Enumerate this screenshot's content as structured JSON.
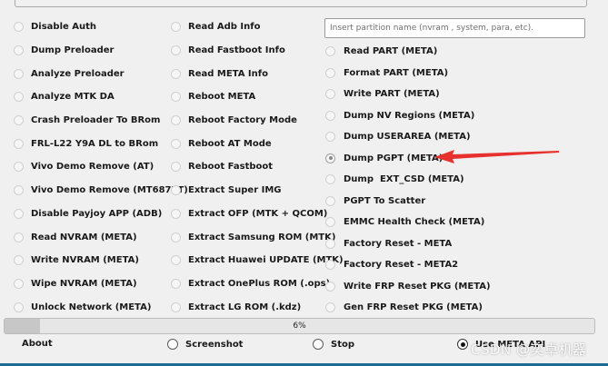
{
  "column1": [
    {
      "label": "Disable Auth"
    },
    {
      "label": "Dump Preloader"
    },
    {
      "label": "Analyze Preloader"
    },
    {
      "label": "Analyze MTK DA"
    },
    {
      "label": "Crash Preloader To BRom"
    },
    {
      "label": "FRL-L22 Y9A DL to BRom"
    },
    {
      "label": "Vivo Demo Remove (AT)"
    },
    {
      "label": "Vivo Demo Remove (MT6877T)"
    },
    {
      "label": "Disable Payjoy APP (ADB)"
    },
    {
      "label": "Read NVRAM (META)"
    },
    {
      "label": "Write NVRAM (META)"
    },
    {
      "label": "Wipe NVRAM (META)"
    },
    {
      "label": "Unlock Network (META)"
    }
  ],
  "column2": [
    {
      "label": "Read Adb Info"
    },
    {
      "label": "Read Fastboot Info"
    },
    {
      "label": "Read META Info"
    },
    {
      "label": "Reboot META"
    },
    {
      "label": "Reboot Factory Mode"
    },
    {
      "label": "Reboot AT Mode"
    },
    {
      "label": "Reboot Fastboot"
    },
    {
      "label": "Extract Super IMG"
    },
    {
      "label": "Extract OFP (MTK + QCOM)"
    },
    {
      "label": "Extract Samsung ROM (MTK)"
    },
    {
      "label": "Extract Huawei UPDATE (MTK)"
    },
    {
      "label": "Extract OnePlus ROM (.ops)"
    },
    {
      "label": "Extract LG ROM (.kdz)"
    }
  ],
  "partition_input": {
    "placeholder": "Insert partition name (nvram , system, para, etc).",
    "value": ""
  },
  "column3": [
    {
      "label": "Read PART (META)",
      "selected": false
    },
    {
      "label": "Format PART (META)",
      "selected": false
    },
    {
      "label": "Write PART (META)",
      "selected": false
    },
    {
      "label": "Dump NV Regions (META)",
      "selected": false
    },
    {
      "label": "Dump USERAREA (META)",
      "selected": false
    },
    {
      "label": "Dump PGPT (META)",
      "selected": true
    },
    {
      "label": "Dump  EXT_CSD (META)",
      "selected": false
    },
    {
      "label": "PGPT To Scatter",
      "selected": false
    },
    {
      "label": "EMMC Health Check (META)",
      "selected": false
    },
    {
      "label": "Factory Reset - META",
      "selected": false
    },
    {
      "label": "Factory Reset - META2",
      "selected": false
    },
    {
      "label": "Write FRP Reset PKG (META)",
      "selected": false
    },
    {
      "label": "Gen FRP Reset PKG (META)",
      "selected": false
    }
  ],
  "progress": {
    "fraction": 0.06,
    "label": "6%"
  },
  "bottom": {
    "about": "About",
    "screenshot": "Screenshot",
    "stop": "Stop",
    "use_meta_api": "Use META API",
    "use_meta_api_checked": true
  },
  "watermark": "CSDN @奕卓机器",
  "colors": {
    "annotation_arrow": "#e8312f",
    "status_line": "#1b6b94"
  }
}
